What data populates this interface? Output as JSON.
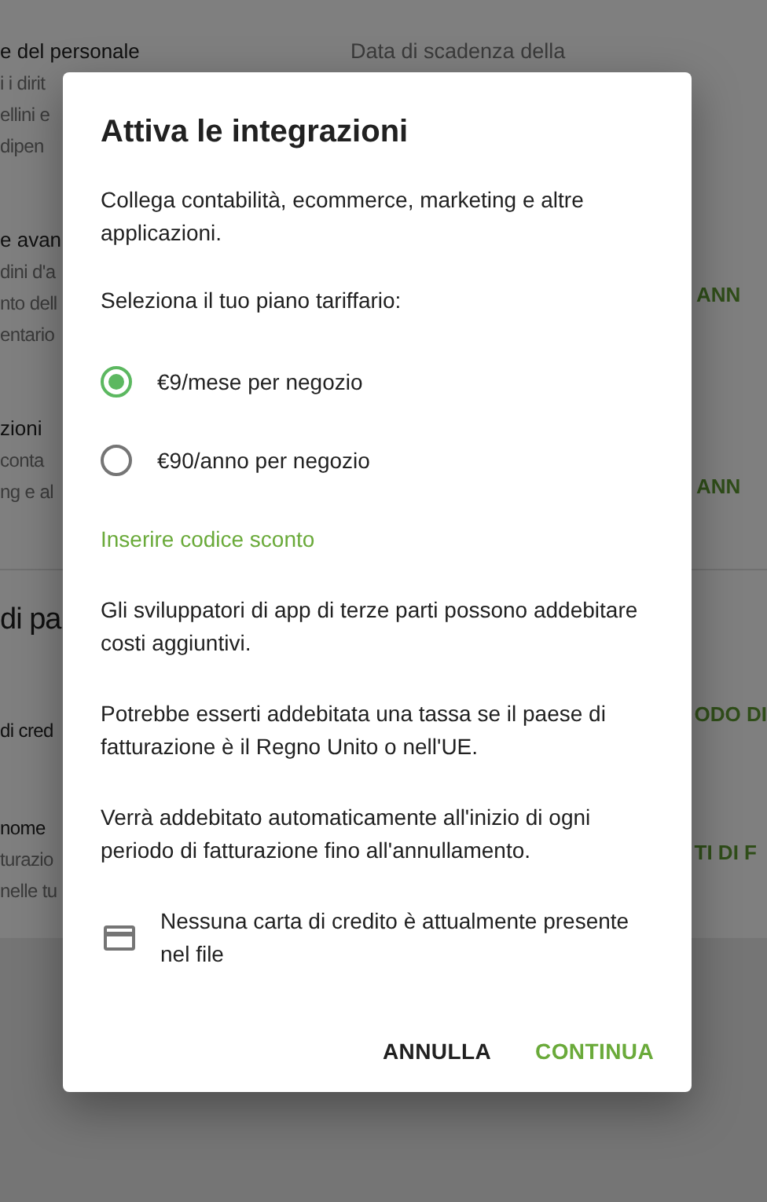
{
  "background": {
    "left_groups": [
      [
        "e del personale",
        "i i dirit",
        "ellini e",
        "dipen"
      ],
      [
        "e avan",
        "dini d'a",
        "nto dell",
        "entario"
      ],
      [
        "zioni",
        "conta",
        "ng e al"
      ]
    ],
    "column_header": "Data di scadenza della",
    "actions": [
      "ANN",
      "ANN"
    ],
    "section_title": "di pa",
    "lower_groups": [
      [
        "di cred"
      ],
      [
        "nome",
        "turazio",
        "nelle tu"
      ]
    ],
    "lower_actions": [
      "ODO DI",
      "TI DI F"
    ]
  },
  "dialog": {
    "title": "Attiva le integrazioni",
    "intro": "Collega contabilità, ecommerce, marketing e altre applicazioni.",
    "plan_label": "Seleziona il tuo piano tariffario:",
    "plans": [
      {
        "label": "€9/mese per negozio",
        "selected": true
      },
      {
        "label": "€90/anno per negozio",
        "selected": false
      }
    ],
    "discount_link": "Inserire codice sconto",
    "notes": [
      "Gli sviluppatori di app di terze parti possono addebitare costi aggiuntivi.",
      "Potrebbe esserti addebitata una tassa se il paese di fatturazione è il Regno Unito o nell'UE.",
      "Verrà addebitato automaticamente all'inizio di ogni periodo di fatturazione fino all'annullamento."
    ],
    "card_notice": "Nessuna carta di credito è attualmente presente nel file",
    "buttons": [
      {
        "label": "ANNULLA",
        "kind": "secondary"
      },
      {
        "label": "CONTINUA",
        "kind": "primary"
      }
    ]
  }
}
